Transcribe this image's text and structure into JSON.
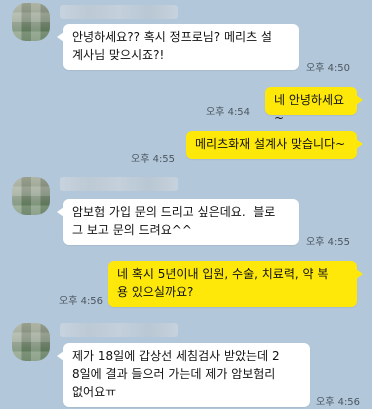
{
  "chat": {
    "messages": [
      {
        "side": "in",
        "text": "안녕하세요?? 혹시 정프로님? 메리츠 설\n계사님 맞으시죠?!",
        "time": "오후 4:50"
      },
      {
        "side": "out",
        "text": "네 안녕하세요~",
        "time": "오후 4:54"
      },
      {
        "side": "out",
        "text": "메리츠화재 설계사 맞습니다~",
        "time": "오후 4:55"
      },
      {
        "side": "in",
        "text": "암보험 가입 문의 드리고 싶은데요.  블로\n그 보고 문의 드려요^^",
        "time": "오후 4:55"
      },
      {
        "side": "out",
        "text": "네 혹시 5년이내 입원, 수술, 치료력, 약 복\n용 있으실까요?",
        "time": "오후 4:56"
      },
      {
        "side": "in",
        "text": "제가 18일에 갑상선 세침검사 받았는데 2\n8일에 결과 들으러 가는데 제가 암보험리\n없어요ㅠ",
        "time": "오후 4:56"
      }
    ]
  }
}
